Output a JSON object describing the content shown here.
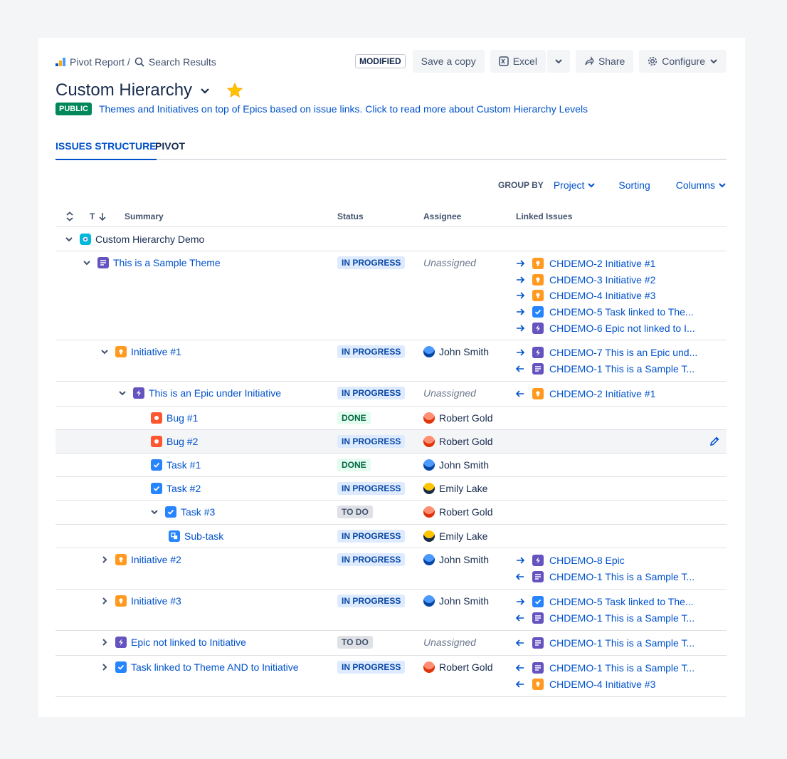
{
  "breadcrumb": {
    "pivot_report": "Pivot Report /",
    "search_results": "Search Results"
  },
  "toolbar": {
    "modified": "MODIFIED",
    "save_copy": "Save a copy",
    "excel": "Excel",
    "share": "Share",
    "configure": "Configure"
  },
  "header": {
    "title": "Custom Hierarchy",
    "badge": "PUBLIC",
    "description": "Themes and Initiatives on top of Epics based on issue links. Click to read more about Custom Hierarchy Levels"
  },
  "tabs": [
    {
      "label": "ISSUES STRUCTURE"
    },
    {
      "label": "PIVOT"
    }
  ],
  "group_bar": {
    "label": "GROUP BY",
    "project": "Project",
    "sorting": "Sorting",
    "columns": "Columns"
  },
  "columns": {
    "t": "T",
    "summary": "Summary",
    "status": "Status",
    "assignee": "Assignee",
    "linked": "Linked Issues"
  },
  "rows": [
    {
      "summary": "Custom Hierarchy Demo"
    },
    {
      "summary": "This is a Sample Theme",
      "status": "IN PROGRESS",
      "assignee": "Unassigned",
      "links": [
        "CHDEMO-2 Initiative #1",
        "CHDEMO-3 Initiative #2",
        "CHDEMO-4 Initiative #3",
        "CHDEMO-5 Task linked to The...",
        "CHDEMO-6 Epic not linked to I..."
      ]
    },
    {
      "summary": "Initiative #1",
      "status": "IN PROGRESS",
      "assignee": "John Smith",
      "links": [
        "CHDEMO-7 This is an Epic und...",
        "CHDEMO-1 This is a Sample T..."
      ]
    },
    {
      "summary": "This is an Epic under Initiative",
      "status": "IN PROGRESS",
      "assignee": "Unassigned",
      "links": [
        "CHDEMO-2 Initiative #1"
      ]
    },
    {
      "summary": "Bug #1",
      "status": "DONE",
      "assignee": "Robert Gold"
    },
    {
      "summary": "Bug #2",
      "status": "IN PROGRESS",
      "assignee": "Robert Gold"
    },
    {
      "summary": "Task #1",
      "status": "DONE",
      "assignee": "John Smith"
    },
    {
      "summary": "Task #2",
      "status": "IN PROGRESS",
      "assignee": "Emily Lake"
    },
    {
      "summary": "Task #3",
      "status": "TO DO",
      "assignee": "Robert Gold"
    },
    {
      "summary": "Sub-task",
      "status": "IN PROGRESS",
      "assignee": "Emily Lake"
    },
    {
      "summary": "Initiative #2",
      "status": "IN PROGRESS",
      "assignee": "John Smith",
      "links": [
        "CHDEMO-8 Epic",
        "CHDEMO-1 This is a Sample T..."
      ]
    },
    {
      "summary": "Initiative #3",
      "status": "IN PROGRESS",
      "assignee": "John Smith",
      "links": [
        "CHDEMO-5 Task linked to The...",
        "CHDEMO-1 This is a Sample T..."
      ]
    },
    {
      "summary": "Epic not linked to Initiative",
      "status": "TO DO",
      "assignee": "Unassigned",
      "links": [
        "CHDEMO-1 This is a Sample T..."
      ]
    },
    {
      "summary": "Task linked to Theme AND to Initiative",
      "status": "IN PROGRESS",
      "assignee": "Robert Gold",
      "links": [
        "CHDEMO-1 This is a Sample T...",
        "CHDEMO-4 Initiative #3"
      ]
    }
  ],
  "colors": {
    "link": "#0052cc",
    "in_progress": "#deebff",
    "done": "#e3fcef",
    "todo": "#dfe1e6",
    "public": "#00875a"
  },
  "icons": [
    "jira-logo-icon",
    "search-icon",
    "excel-icon",
    "share-icon",
    "gear-icon",
    "chevron-down-icon",
    "star-icon",
    "sort-icon",
    "pencil-icon",
    "arrow-right-icon",
    "arrow-left-icon"
  ]
}
